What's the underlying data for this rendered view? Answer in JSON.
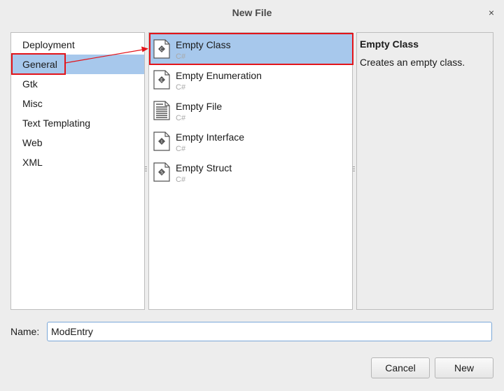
{
  "window": {
    "title": "New File",
    "close_glyph": "×"
  },
  "categories": {
    "items": [
      {
        "label": "Deployment"
      },
      {
        "label": "General",
        "selected": true
      },
      {
        "label": "Gtk"
      },
      {
        "label": "Misc"
      },
      {
        "label": "Text Templating"
      },
      {
        "label": "Web"
      },
      {
        "label": "XML"
      }
    ]
  },
  "templates": {
    "items": [
      {
        "name": "Empty Class",
        "lang": "C#",
        "icon": "class-file-icon",
        "selected": true
      },
      {
        "name": "Empty Enumeration",
        "lang": "C#",
        "icon": "enum-file-icon"
      },
      {
        "name": "Empty File",
        "lang": "C#",
        "icon": "text-file-icon"
      },
      {
        "name": "Empty Interface",
        "lang": "C#",
        "icon": "interface-file-icon"
      },
      {
        "name": "Empty Struct",
        "lang": "C#",
        "icon": "struct-file-icon"
      }
    ]
  },
  "description": {
    "title": "Empty Class",
    "text": "Creates an empty class."
  },
  "name_field": {
    "label": "Name:",
    "value": "ModEntry"
  },
  "buttons": {
    "cancel": "Cancel",
    "new": "New"
  },
  "colors": {
    "selection": "#a7c8ec",
    "annotation": "#e3141a",
    "background": "#ededed"
  }
}
